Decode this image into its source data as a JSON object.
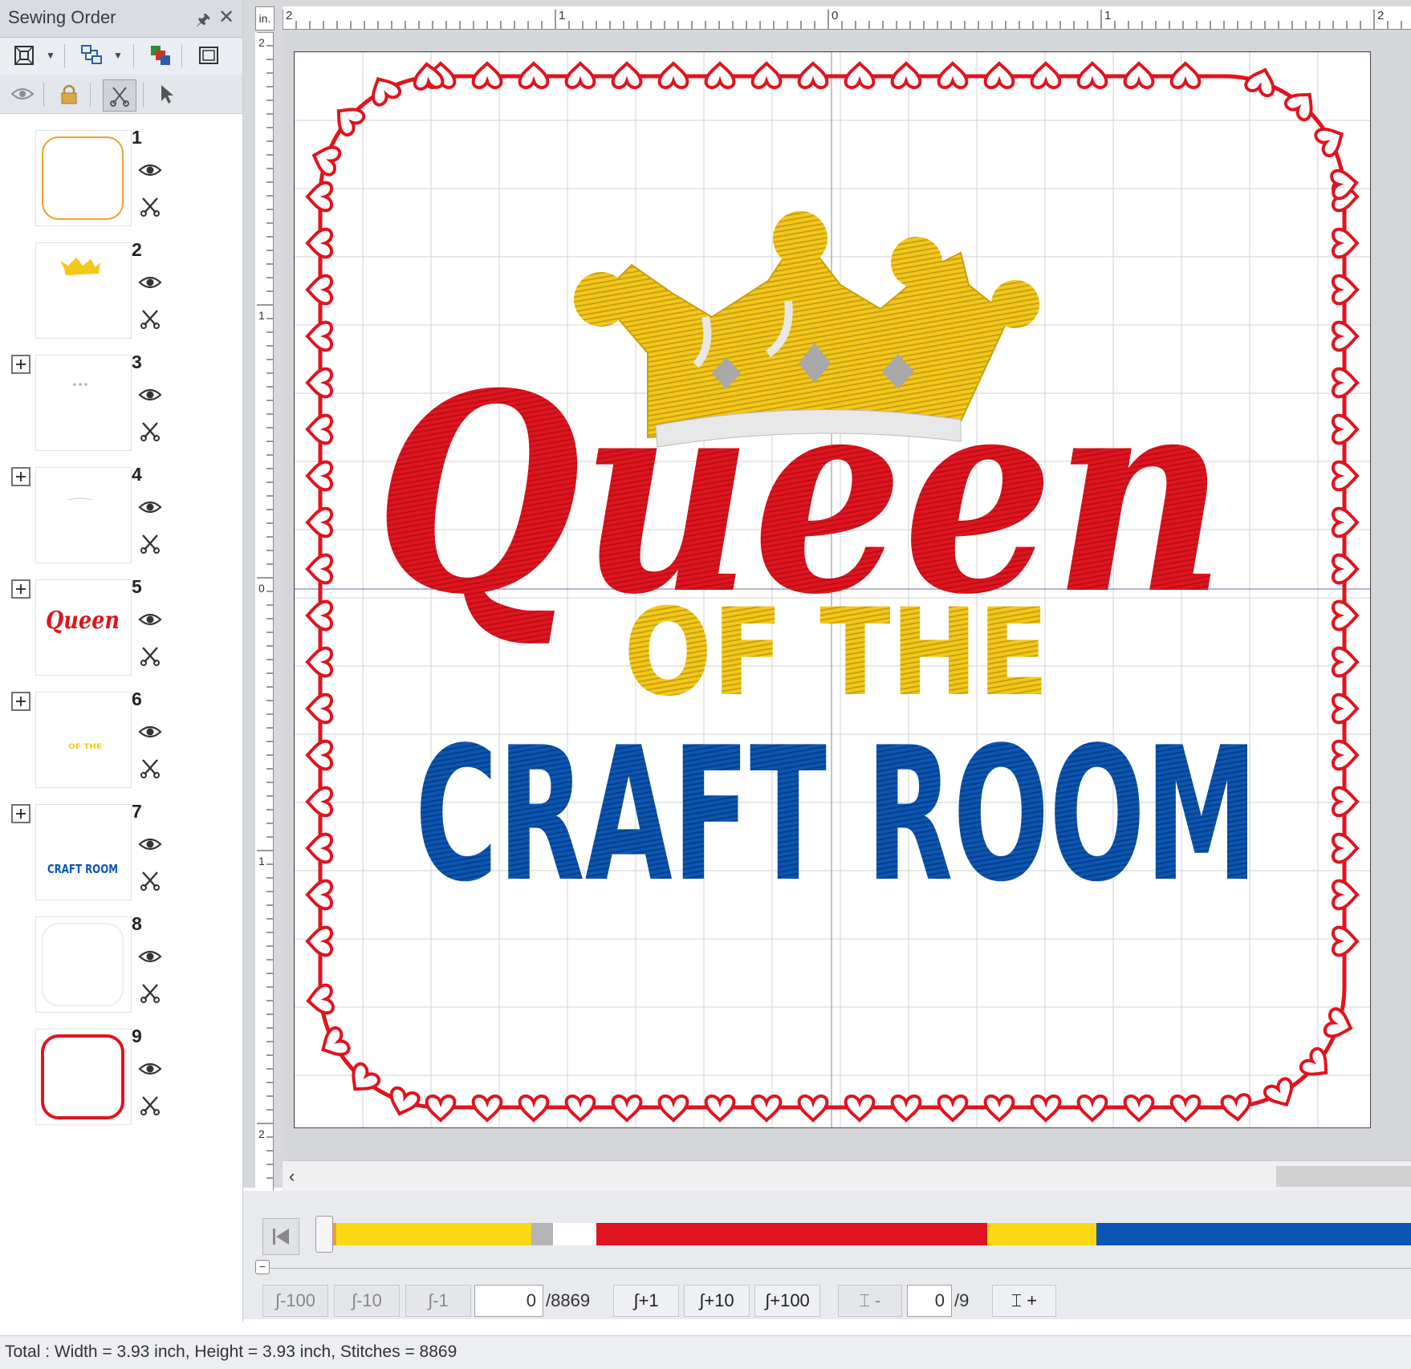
{
  "pane": {
    "title": "Sewing Order",
    "items": [
      {
        "num": "1",
        "expandable": false
      },
      {
        "num": "2",
        "expandable": false
      },
      {
        "num": "3",
        "expandable": true
      },
      {
        "num": "4",
        "expandable": true
      },
      {
        "num": "5",
        "expandable": true
      },
      {
        "num": "6",
        "expandable": true
      },
      {
        "num": "7",
        "expandable": true
      },
      {
        "num": "8",
        "expandable": false
      },
      {
        "num": "9",
        "expandable": false
      }
    ]
  },
  "ruler": {
    "unit": "in.",
    "top_labels": [
      "2",
      "1",
      "0",
      "1",
      "2"
    ],
    "left_labels": [
      "2",
      "1",
      "0",
      "1",
      "2"
    ]
  },
  "design": {
    "word1": "Queen",
    "word2": "OF THE",
    "word3": "CRAFT ROOM",
    "thumb_word1": "Queen",
    "thumb_word2": "OF THE",
    "thumb_word3": "CRAFT ROOM"
  },
  "colors": {
    "red": "#e0141e",
    "yellow": "#f4c81a",
    "blue": "#0a56b4",
    "gray": "#a8a8a8",
    "orange": "#f0a030"
  },
  "simulator": {
    "color_segments": [
      {
        "color": "#f0a030",
        "fraction": 0.01
      },
      {
        "color": "#fcd915",
        "fraction": 0.18
      },
      {
        "color": "#b4b4b4",
        "fraction": 0.02
      },
      {
        "color": "#ffffff",
        "fraction": 0.04
      },
      {
        "color": "#e0141e",
        "fraction": 0.36
      },
      {
        "color": "#fcd915",
        "fraction": 0.1
      },
      {
        "color": "#0a56b4",
        "fraction": 0.29
      }
    ],
    "buttons": {
      "m100": "-100",
      "m10": "-10",
      "m1": "-1",
      "p1": "+1",
      "p10": "+10",
      "p100": "+100",
      "frame_minus": "-",
      "frame_plus": "+"
    },
    "stitch_current": "0",
    "stitch_total": "/8869",
    "color_current": "0",
    "color_total": "/9"
  },
  "status": {
    "text": "Total : Width = 3.93 inch, Height = 3.93 inch, Stitches = 8869"
  }
}
